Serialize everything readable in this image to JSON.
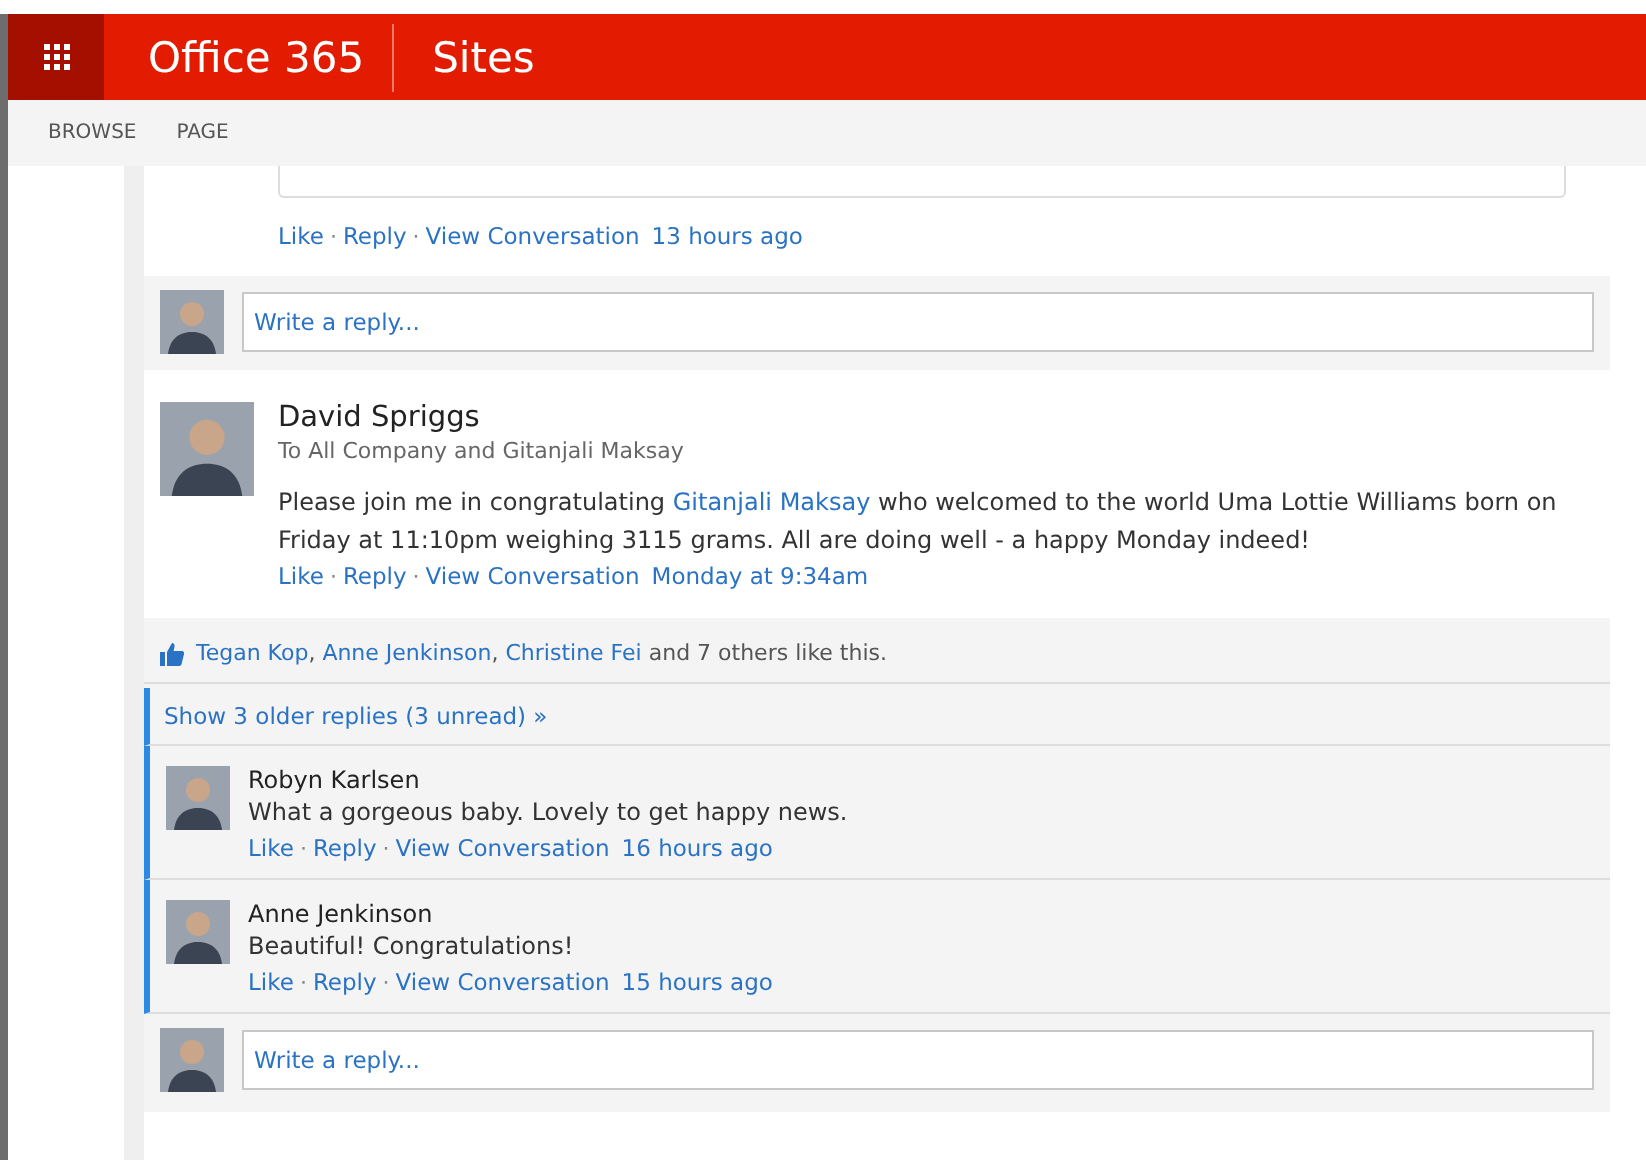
{
  "header": {
    "app_title": "Office 365",
    "site_title": "Sites"
  },
  "nav": {
    "tabs": [
      "BROWSE",
      "PAGE"
    ]
  },
  "feed": {
    "separator": "·",
    "previous_post": {
      "actions": [
        "Like",
        "Reply",
        "View Conversation"
      ],
      "time": "13 hours ago"
    },
    "composer_1": {
      "placeholder": "Write a reply..."
    },
    "post": {
      "author": "David Spriggs",
      "audience": "To All Company and Gitanjali Maksay",
      "body": [
        {
          "kind": "text",
          "text": "Please join me in congratulating "
        },
        {
          "kind": "link",
          "text": "Gitanjali Maksay"
        },
        {
          "kind": "text",
          "text": " who welcomed to the world Uma Lottie Williams born on Friday at 11:10pm weighing 3115 grams. All are doing well - a happy Monday indeed!"
        }
      ],
      "actions": [
        "Like",
        "Reply",
        "View Conversation"
      ],
      "time": "Monday at 9:34am"
    },
    "likes": {
      "list_separator": ", ",
      "people": [
        "Tegan Kop",
        "Anne Jenkinson",
        "Christine Fei"
      ],
      "suffix": "and 7 others like this."
    },
    "older_replies": "Show 3 older replies (3 unread) »",
    "replies": [
      {
        "author": "Robyn Karlsen",
        "text": "What a gorgeous baby. Lovely to get happy news.",
        "actions": [
          "Like",
          "Reply",
          "View Conversation"
        ],
        "time": "16 hours ago",
        "unread": true
      },
      {
        "author": "Anne Jenkinson",
        "text": "Beautiful! Congratulations!",
        "actions": [
          "Like",
          "Reply",
          "View Conversation"
        ],
        "time": "15 hours ago",
        "unread": true
      }
    ],
    "composer_2": {
      "placeholder": "Write a reply..."
    }
  }
}
